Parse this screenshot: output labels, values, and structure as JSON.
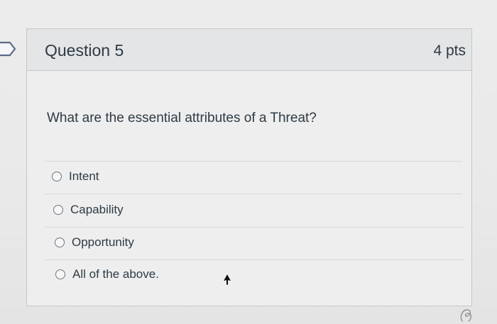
{
  "question": {
    "title": "Question 5",
    "points": "4 pts",
    "prompt": "What are the essential attributes of a Threat?",
    "answers": [
      {
        "label": "Intent",
        "selected": false
      },
      {
        "label": "Capability",
        "selected": false
      },
      {
        "label": "Opportunity",
        "selected": false
      },
      {
        "label": "All of the above.",
        "selected": false
      }
    ]
  },
  "colors": {
    "text": "#2d3b45",
    "header_bg": "#e4e5e6",
    "card_bg": "#eeeeee",
    "border": "#c4c7ca",
    "radio_border": "#6b7780"
  },
  "icons": {
    "flag": "flag-question-icon",
    "cursor": "mouse-pointer-icon"
  }
}
